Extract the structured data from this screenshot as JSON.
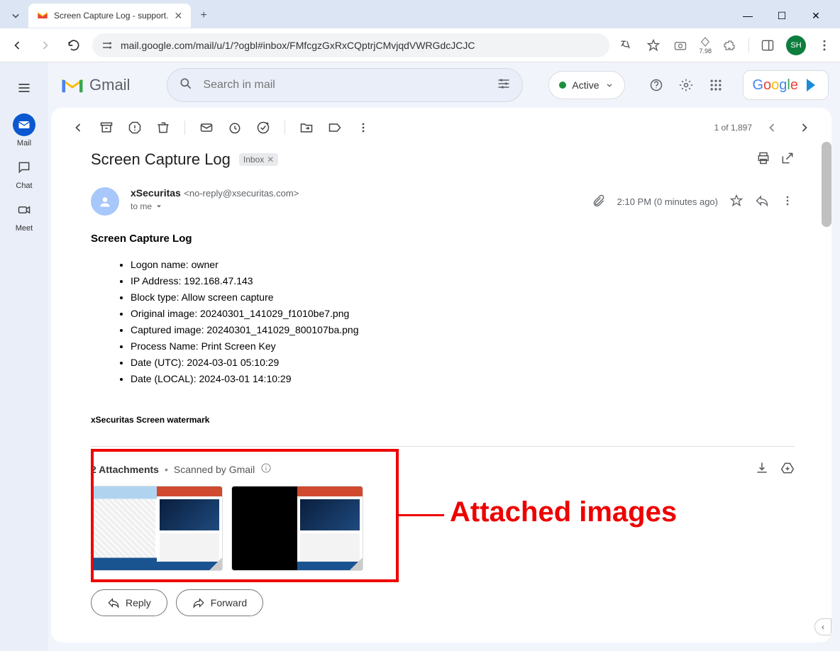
{
  "browser": {
    "tab_title": "Screen Capture Log - support.",
    "url": "mail.google.com/mail/u/1/?ogbl#inbox/FMfcgzGxRxCQptrjCMvjqdVWRGdcJCJC",
    "ext_label": "7.98",
    "avatar_initials": "SH"
  },
  "rail": {
    "mail": "Mail",
    "chat": "Chat",
    "meet": "Meet"
  },
  "header": {
    "product": "Gmail",
    "search_placeholder": "Search in mail",
    "status": "Active",
    "company": "Google"
  },
  "toolbar": {
    "counter": "1 of 1,897"
  },
  "email": {
    "subject": "Screen Capture Log",
    "label": "Inbox",
    "sender_name": "xSecuritas",
    "sender_email": "<no-reply@xsecuritas.com>",
    "recipient": "to me",
    "time": "2:10 PM (0 minutes ago)",
    "body_title": "Screen Capture Log",
    "items": {
      "logon": "Logon name: owner",
      "ip": "IP Address: 192.168.47.143",
      "block": "Block type: Allow screen capture",
      "original": "Original image: 20240301_141029_f1010be7.png",
      "captured": "Captured image: 20240301_141029_800107ba.png",
      "process": "Process Name: Print Screen Key",
      "utc": "Date (UTC): 2024-03-01 05:10:29",
      "local": "Date (LOCAL): 2024-03-01 14:10:29"
    },
    "footer": "xSecuritas Screen watermark"
  },
  "attachments": {
    "count_label": "2 Attachments",
    "scan_label": "Scanned by Gmail"
  },
  "actions": {
    "reply": "Reply",
    "forward": "Forward"
  },
  "annotation": {
    "label": "Attached images"
  }
}
